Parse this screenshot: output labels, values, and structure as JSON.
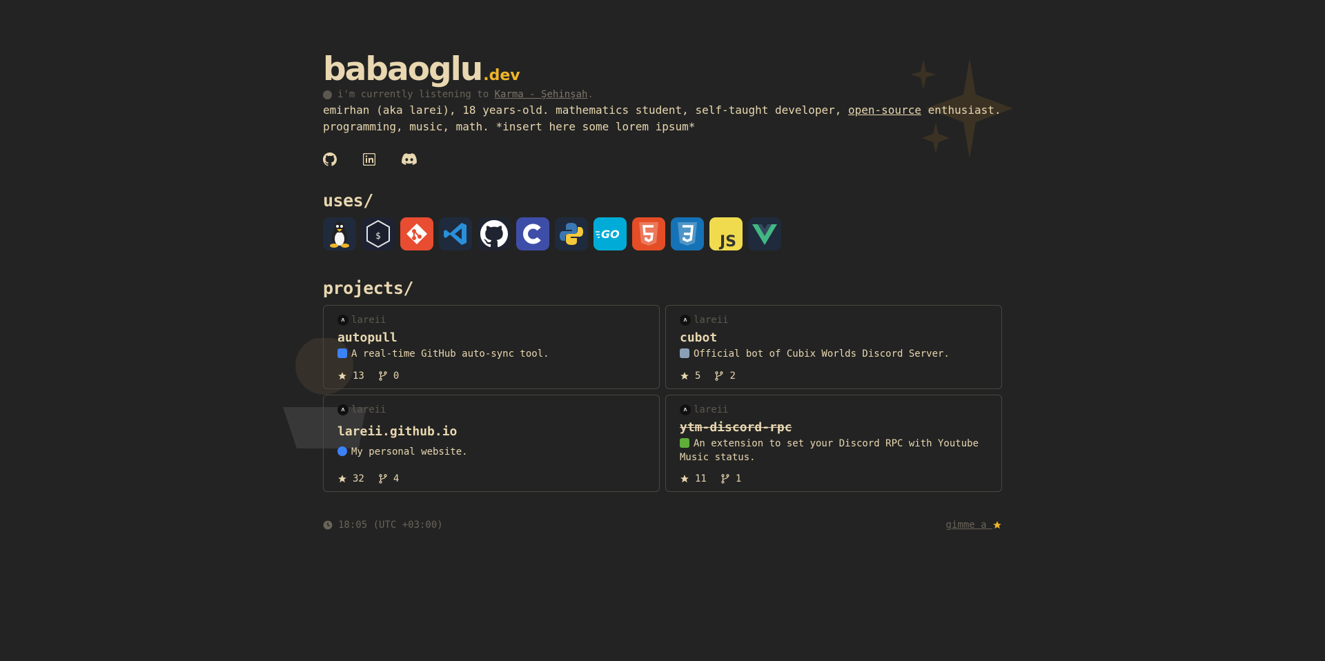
{
  "brand": {
    "name": "babaoglu",
    "tld": ".dev"
  },
  "listening": {
    "prefix": "i'm currently listening to",
    "song": "Karma - Şehinşah",
    "suffix": "."
  },
  "bio": {
    "line1_before": "emirhan (aka larei), 18 years-old. mathematics student, self-taught developer,",
    "link": "open-source",
    "line1_after": "enthusiast.",
    "line2": "programming, music, math. *insert here some lorem ipsum*"
  },
  "socials": [
    "github-icon",
    "linkedin-icon",
    "discord-icon"
  ],
  "uses": {
    "title": "uses/",
    "tools": [
      "linux",
      "bash",
      "git",
      "vscode",
      "github",
      "c",
      "python",
      "go",
      "html5",
      "css3",
      "javascript",
      "vue"
    ]
  },
  "projects": {
    "title": "projects/",
    "items": [
      {
        "owner": "lareii",
        "name": "autopull",
        "emoji": "repeat-emoji",
        "desc": "A real-time GitHub auto-sync tool.",
        "stars": "13",
        "forks": "0",
        "strike": false
      },
      {
        "owner": "lareii",
        "name": "cubot",
        "emoji": "robot-emoji",
        "desc": "Official bot of Cubix Worlds Discord Server.",
        "stars": "5",
        "forks": "2",
        "strike": false
      },
      {
        "owner": "lareii",
        "name": "lareii.github.io",
        "emoji": "globe-emoji",
        "desc": "My personal website.",
        "stars": "32",
        "forks": "4",
        "strike": false
      },
      {
        "owner": "lareii",
        "name": "ytm-discord-rpc",
        "emoji": "puzzle-emoji",
        "desc": "An extension to set your Discord RPC with Youtube Music status.",
        "stars": "11",
        "forks": "1",
        "strike": true
      }
    ]
  },
  "footer": {
    "time": "18:05 (UTC +03:00)",
    "star_text": "gimme a"
  },
  "colors": {
    "bg": "#232323",
    "text": "#e8d7b0",
    "accent": "#f0b429",
    "muted": "#6a6459",
    "border": "#4a4740"
  }
}
